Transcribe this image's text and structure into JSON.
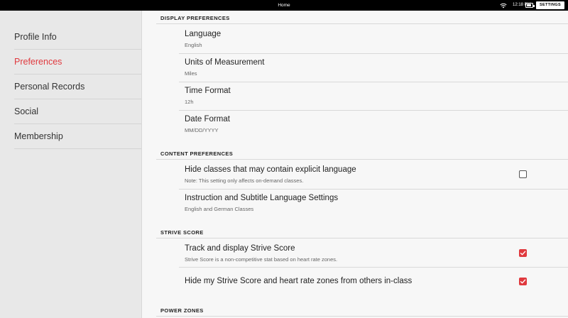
{
  "status_bar": {
    "title": "Home",
    "time": "12:18 PM",
    "settings_label": "SETTINGS",
    "battery_level": 0.85,
    "icons": [
      "wifi-icon",
      "battery-icon"
    ]
  },
  "sidebar": {
    "items": [
      {
        "label": "Profile Info",
        "active": false
      },
      {
        "label": "Preferences",
        "active": true
      },
      {
        "label": "Personal Records",
        "active": false
      },
      {
        "label": "Social",
        "active": false
      },
      {
        "label": "Membership",
        "active": false
      }
    ]
  },
  "main": {
    "sections": [
      {
        "header": "DISPLAY PREFERENCES",
        "rows": [
          {
            "title": "Language",
            "subtitle": "English"
          },
          {
            "title": "Units of Measurement",
            "subtitle": "Miles"
          },
          {
            "title": "Time Format",
            "subtitle": "12h"
          },
          {
            "title": "Date Format",
            "subtitle": "MM/DD/YYYY"
          }
        ]
      },
      {
        "header": "CONTENT PREFERENCES",
        "rows": [
          {
            "title": "Hide classes that may contain explicit language",
            "subtitle": "Note: This setting only affects on-demand classes.",
            "checked": false
          },
          {
            "title": "Instruction and Subtitle Language Settings",
            "subtitle": "English and German Classes"
          }
        ]
      },
      {
        "header": "STRIVE SCORE",
        "rows": [
          {
            "title": "Track and display Strive Score",
            "subtitle": "Strive Score is a non-competitive stat based on heart rate zones.",
            "checked": true
          },
          {
            "title": "Hide my Strive Score and heart rate zones from others in-class",
            "checked": true
          }
        ]
      },
      {
        "header": "POWER ZONES",
        "rows": []
      }
    ]
  },
  "colors": {
    "accent": "#e0393e",
    "sidebar_bg": "#e8e8e8",
    "main_bg": "#f7f7f7",
    "status_bar_bg": "#000000"
  }
}
